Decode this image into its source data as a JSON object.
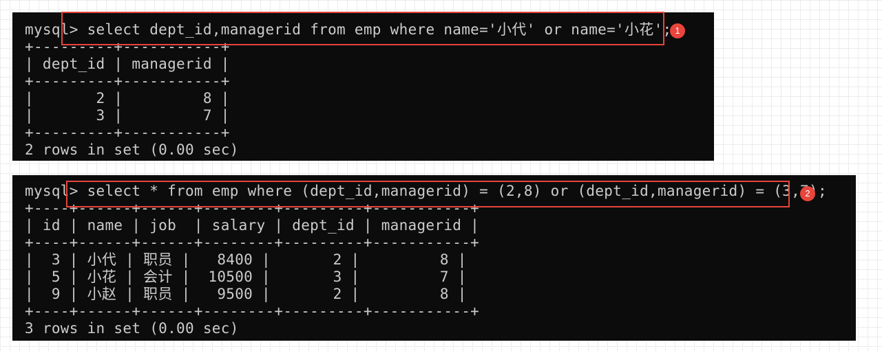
{
  "query1": {
    "prompt": "mysql>",
    "command": " select dept_id,managerid from emp where name='小代' or name='小花';",
    "lines": [
      "+---------+-----------+",
      "| dept_id | managerid |",
      "+---------+-----------+",
      "|       2 |         8 |",
      "|       3 |         7 |",
      "+---------+-----------+"
    ],
    "footer": "2 rows in set (0.00 sec)",
    "badge": "1"
  },
  "query2": {
    "prompt": "mysql>",
    "command": " select * from emp where (dept_id,managerid) = (2,8) or (dept_id,managerid) = (3,7);",
    "lines": [
      "+----+------+------+--------+---------+-----------+",
      "| id | name | job  | salary | dept_id | managerid |",
      "+----+------+------+--------+---------+-----------+",
      "|  3 | 小代 | 职员 |   8400 |       2 |         8 |",
      "|  5 | 小花 | 会计 |  10500 |       3 |         7 |",
      "|  9 | 小赵 | 职员 |   9500 |       2 |         8 |",
      "+----+------+------+--------+---------+-----------+"
    ],
    "footer": "3 rows in set (0.00 sec)",
    "badge": "2"
  },
  "colors": {
    "terminal_bg": "#0c0c0c",
    "terminal_text": "#cccccc",
    "highlight": "#e8453c"
  }
}
